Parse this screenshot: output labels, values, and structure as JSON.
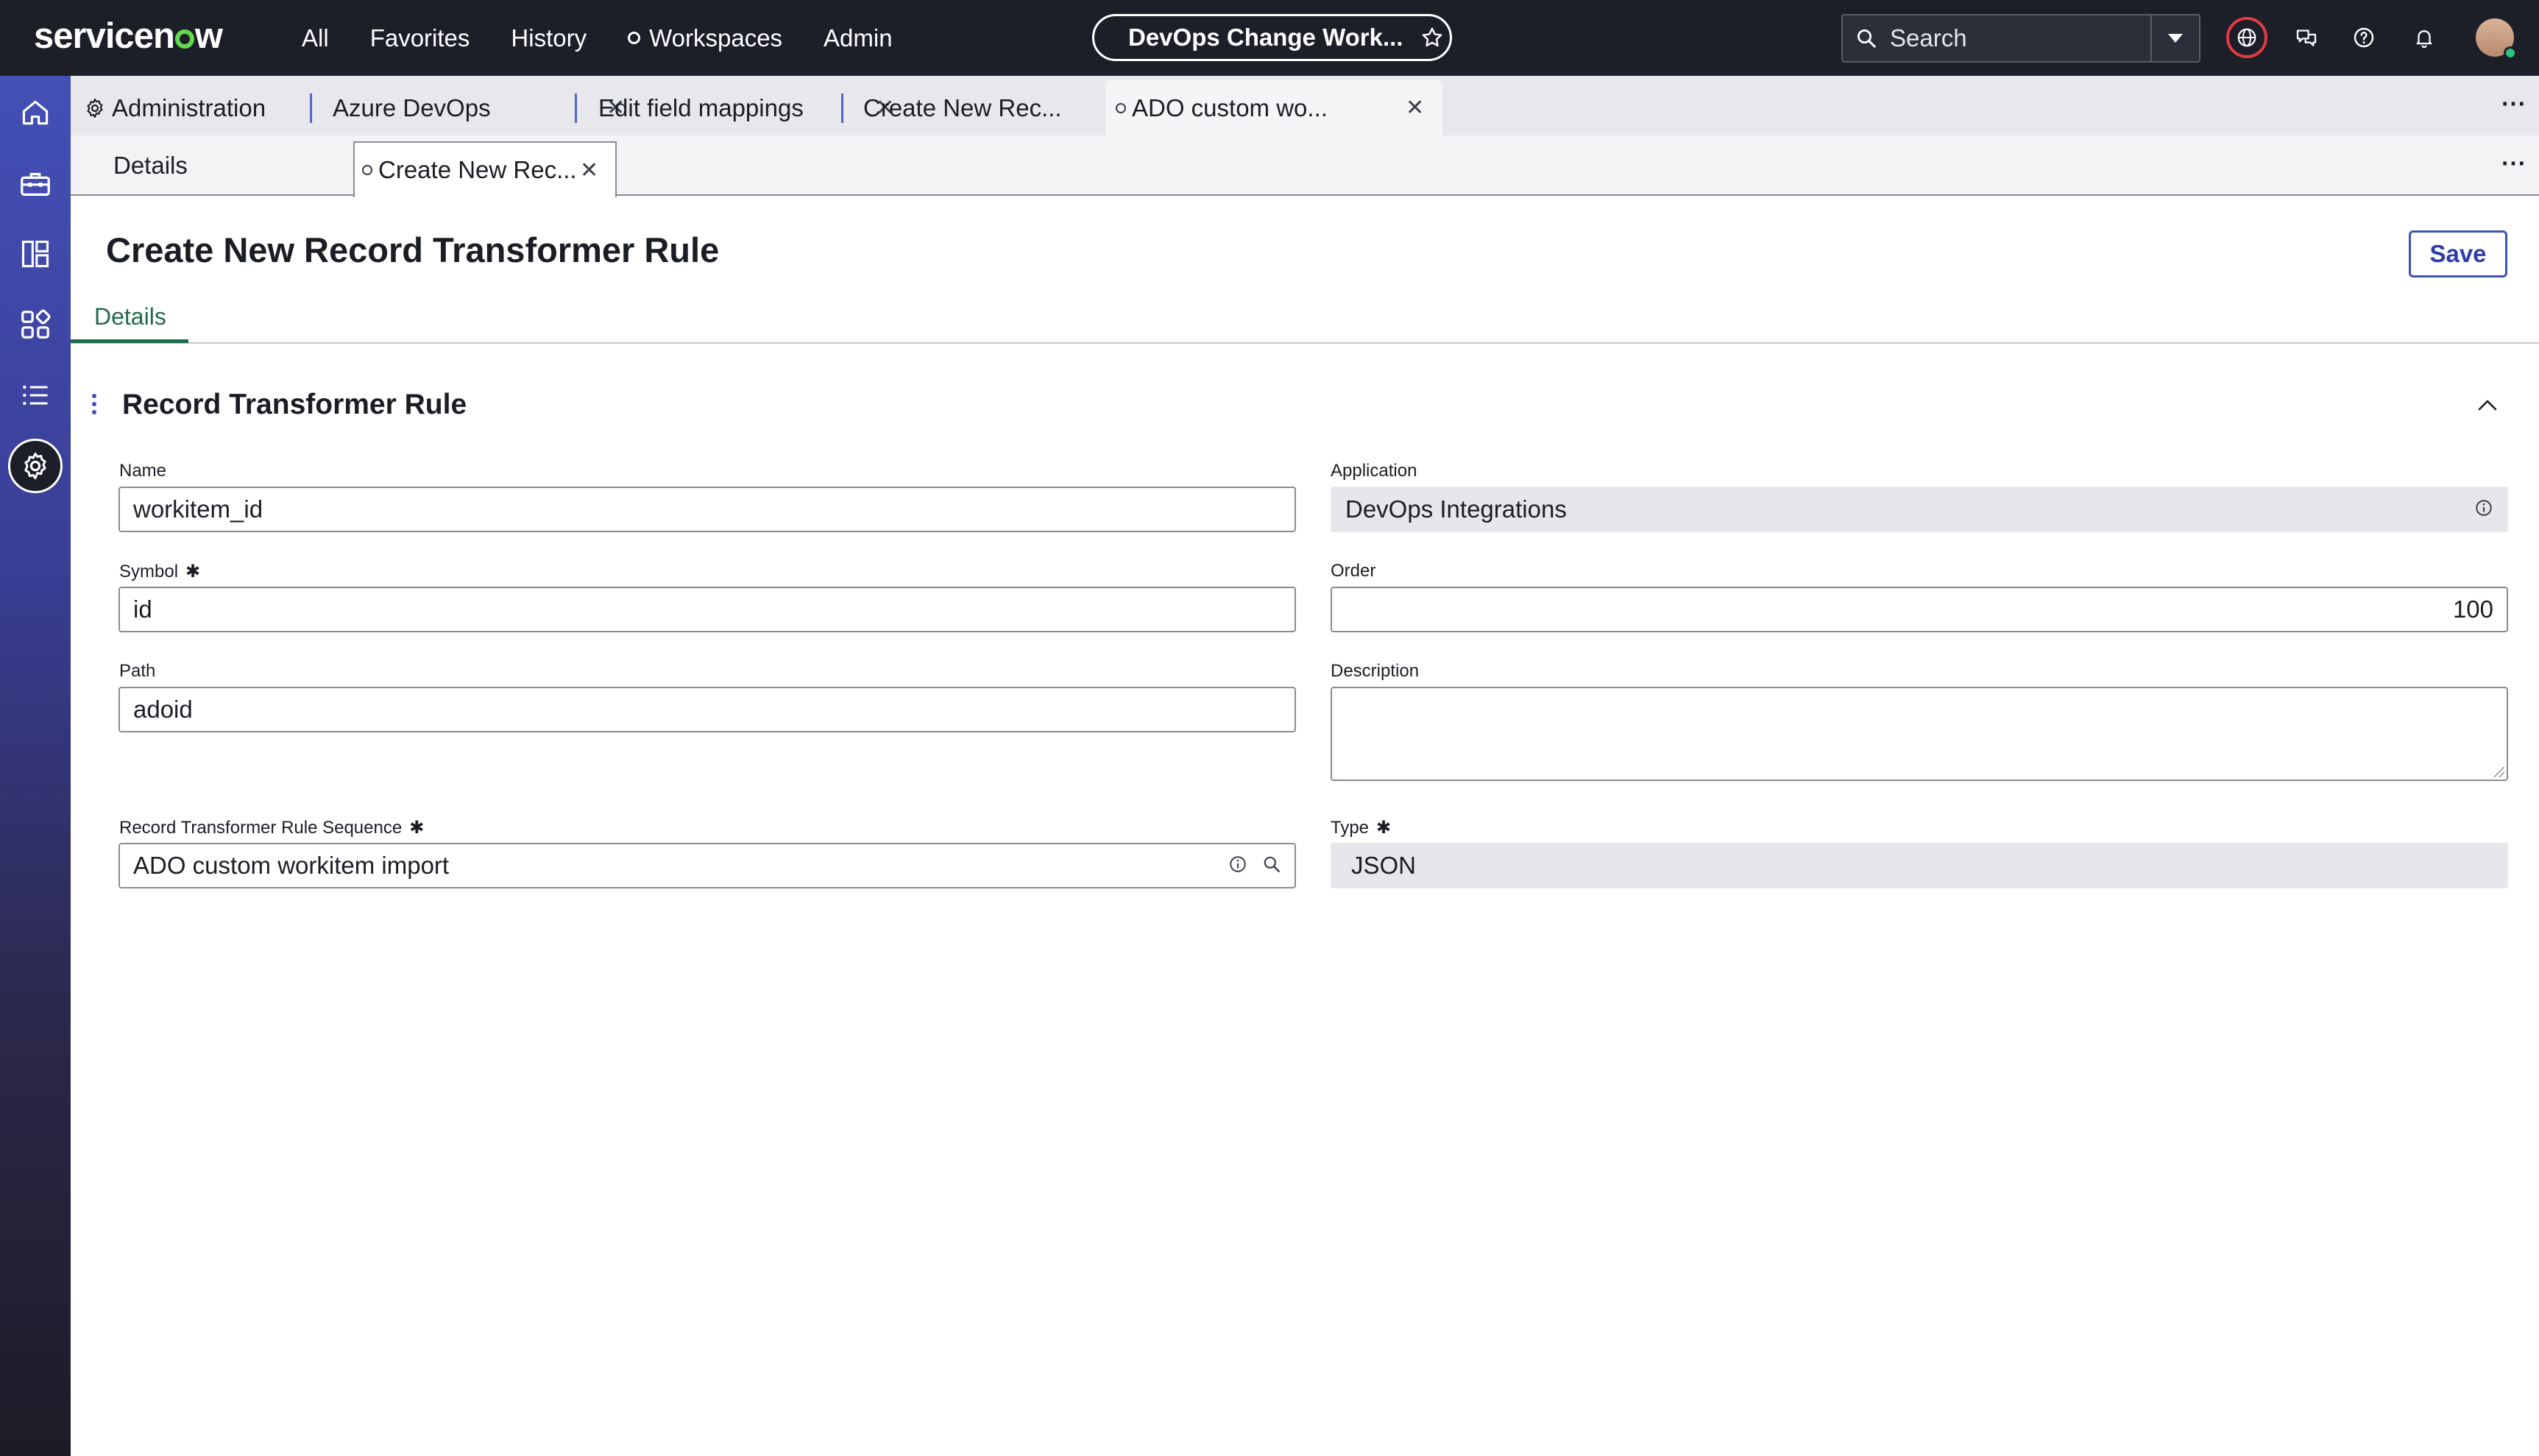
{
  "topbar": {
    "brand": "servicenow",
    "nav": {
      "all": "All",
      "favorites": "Favorites",
      "history": "History",
      "workspaces": "Workspaces",
      "admin": "Admin"
    },
    "context_pill": "DevOps Change Work...",
    "search_placeholder": "Search"
  },
  "app_tabs": [
    {
      "label": "Administration"
    },
    {
      "label": "Azure DevOps"
    },
    {
      "label": "Edit field mappings"
    },
    {
      "label": "Create New Rec..."
    },
    {
      "label": "ADO custom wo..."
    }
  ],
  "sub_tabs": [
    {
      "label": "Details"
    },
    {
      "label": "Create New Rec..."
    }
  ],
  "form": {
    "title": "Create New Record Transformer Rule",
    "save_label": "Save",
    "tab_details": "Details",
    "section_title": "Record Transformer Rule",
    "fields": {
      "name": {
        "label": "Name",
        "value": "workitem_id"
      },
      "application": {
        "label": "Application",
        "value": "DevOps Integrations"
      },
      "symbol": {
        "label": "Symbol",
        "value": "id",
        "required_mark": "✱"
      },
      "order": {
        "label": "Order",
        "value": "100"
      },
      "path": {
        "label": "Path",
        "value": "adoid"
      },
      "description": {
        "label": "Description",
        "value": ""
      },
      "sequence": {
        "label": "Record Transformer Rule Sequence",
        "value": "ADO custom workitem import",
        "required_mark": "✱"
      },
      "type": {
        "label": "Type",
        "value": "JSON",
        "required_mark": "✱"
      }
    }
  },
  "colors": {
    "topbar_bg": "#1c1e28",
    "accent_blue": "#3e52b4",
    "accent_green": "#1e6b4a",
    "status_green": "#62d84e",
    "globe_ring": "#e43a46"
  }
}
